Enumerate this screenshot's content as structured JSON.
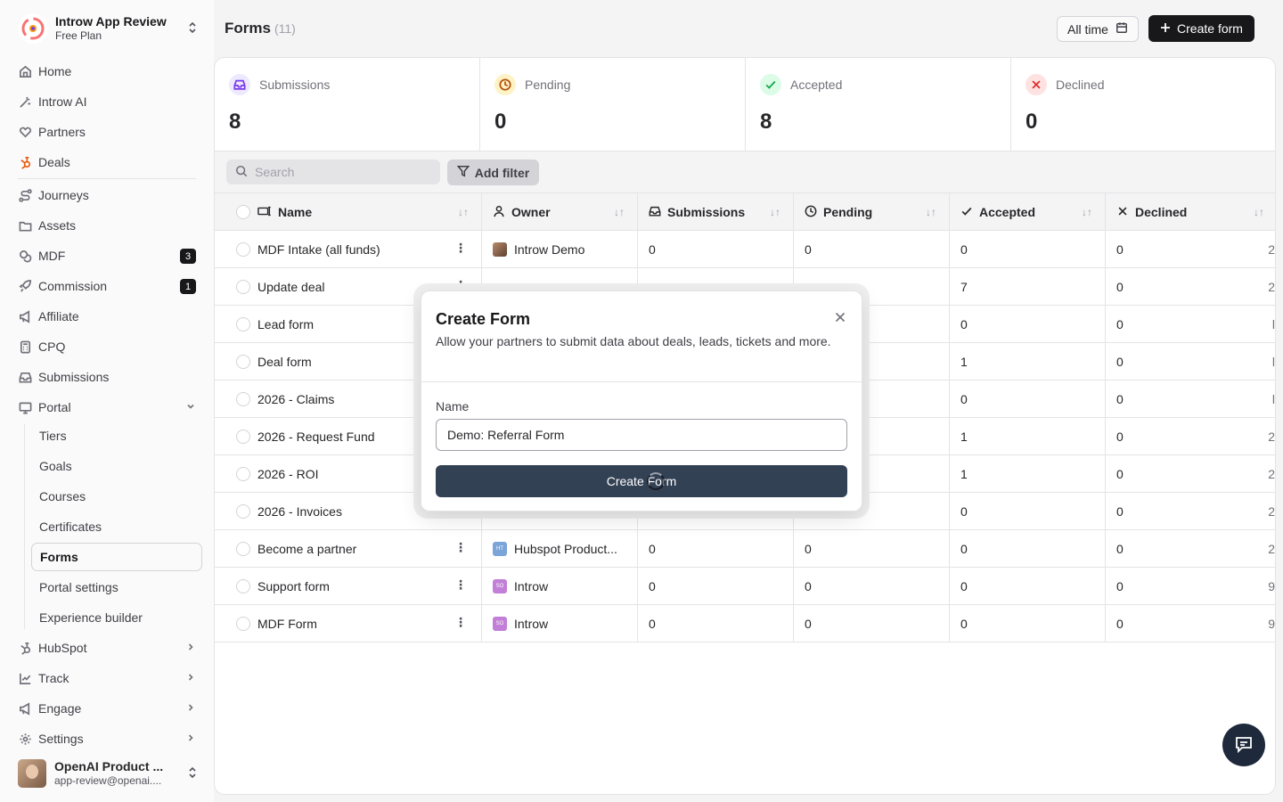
{
  "workspace": {
    "name": "Introw App Review",
    "plan": "Free Plan"
  },
  "sidebar": {
    "items": [
      {
        "label": "Home",
        "icon": "home-icon"
      },
      {
        "label": "Introw AI",
        "icon": "sparkle-icon"
      },
      {
        "label": "Partners",
        "icon": "handshake-icon"
      },
      {
        "label": "Deals",
        "icon": "hubspot-icon"
      },
      {
        "label": "Journeys",
        "icon": "route-icon"
      },
      {
        "label": "Assets",
        "icon": "folder-icon"
      },
      {
        "label": "MDF",
        "icon": "coins-icon",
        "badge": "3"
      },
      {
        "label": "Commission",
        "icon": "rocket-icon",
        "badge": "1"
      },
      {
        "label": "Affiliate",
        "icon": "megaphone-icon"
      },
      {
        "label": "CPQ",
        "icon": "calculator-icon"
      },
      {
        "label": "Submissions",
        "icon": "inbox-icon"
      },
      {
        "label": "Portal",
        "icon": "monitor-icon"
      }
    ],
    "portal_sub": [
      "Tiers",
      "Goals",
      "Courses",
      "Certificates",
      "Forms",
      "Portal settings",
      "Experience builder"
    ],
    "bottom_items": [
      {
        "label": "HubSpot",
        "icon": "hubspot-icon"
      },
      {
        "label": "Track",
        "icon": "chart-line-icon"
      },
      {
        "label": "Engage",
        "icon": "megaphone-icon"
      },
      {
        "label": "Settings",
        "icon": "gear-icon"
      }
    ]
  },
  "user": {
    "name": "OpenAI Product ...",
    "email": "app-review@openai...."
  },
  "header": {
    "title": "Forms",
    "count": "(11)",
    "date_filter": "All time",
    "create_label": "Create form"
  },
  "stats": [
    {
      "label": "Submissions",
      "value": "8",
      "icon": "inbox-icon",
      "color": "#7c3aed",
      "bg": "#ede9fe"
    },
    {
      "label": "Pending",
      "value": "0",
      "icon": "clock-icon",
      "color": "#b45309",
      "bg": "#fef3c7"
    },
    {
      "label": "Accepted",
      "value": "8",
      "icon": "check-icon",
      "color": "#16a34a",
      "bg": "#dcfce7"
    },
    {
      "label": "Declined",
      "value": "0",
      "icon": "x-icon",
      "color": "#dc2626",
      "bg": "#fee2e2"
    }
  ],
  "toolbar": {
    "search_placeholder": "Search",
    "filter_label": "Add filter"
  },
  "table": {
    "columns": [
      "Name",
      "Owner",
      "Submissions",
      "Pending",
      "Accepted",
      "Declined"
    ],
    "rows": [
      {
        "name": "MDF Intake (all funds)",
        "owner": "Introw Demo",
        "owner_type": "photo",
        "submissions": "0",
        "pending": "0",
        "accepted": "0",
        "declined": "0",
        "trail": "2"
      },
      {
        "name": "Update deal",
        "owner": "",
        "owner_type": "",
        "submissions": "",
        "pending": "",
        "accepted": "7",
        "declined": "0",
        "trail": "2"
      },
      {
        "name": "Lead form",
        "owner": "",
        "owner_type": "",
        "submissions": "",
        "pending": "",
        "accepted": "0",
        "declined": "0",
        "trail": "l"
      },
      {
        "name": "Deal form",
        "owner": "",
        "owner_type": "",
        "submissions": "",
        "pending": "",
        "accepted": "1",
        "declined": "0",
        "trail": "l"
      },
      {
        "name": "2026 - Claims",
        "owner": "",
        "owner_type": "",
        "submissions": "",
        "pending": "",
        "accepted": "0",
        "declined": "0",
        "trail": "l"
      },
      {
        "name": "2026 - Request Fund",
        "owner": "",
        "owner_type": "",
        "submissions": "",
        "pending": "",
        "accepted": "1",
        "declined": "0",
        "trail": "2"
      },
      {
        "name": "2026 - ROI",
        "owner": "",
        "owner_type": "",
        "submissions": "",
        "pending": "",
        "accepted": "1",
        "declined": "0",
        "trail": "2"
      },
      {
        "name": "2026 - Invoices",
        "owner": "",
        "owner_type": "",
        "submissions": "",
        "pending": "",
        "accepted": "0",
        "declined": "0",
        "trail": "2"
      },
      {
        "name": "Become a partner",
        "owner": "Hubspot Product...",
        "owner_type": "ht",
        "submissions": "0",
        "pending": "0",
        "accepted": "0",
        "declined": "0",
        "trail": "2"
      },
      {
        "name": "Support form",
        "owner": "Introw",
        "owner_type": "so",
        "submissions": "0",
        "pending": "0",
        "accepted": "0",
        "declined": "0",
        "trail": "9"
      },
      {
        "name": "MDF Form",
        "owner": "Introw",
        "owner_type": "so",
        "submissions": "0",
        "pending": "0",
        "accepted": "0",
        "declined": "0",
        "trail": "9"
      }
    ]
  },
  "modal": {
    "title": "Create Form",
    "description": "Allow your partners to submit data about deals, leads, tickets and more.",
    "field_label": "Name",
    "field_value": "Demo: Referral Form",
    "submit_label": "Create Form"
  }
}
